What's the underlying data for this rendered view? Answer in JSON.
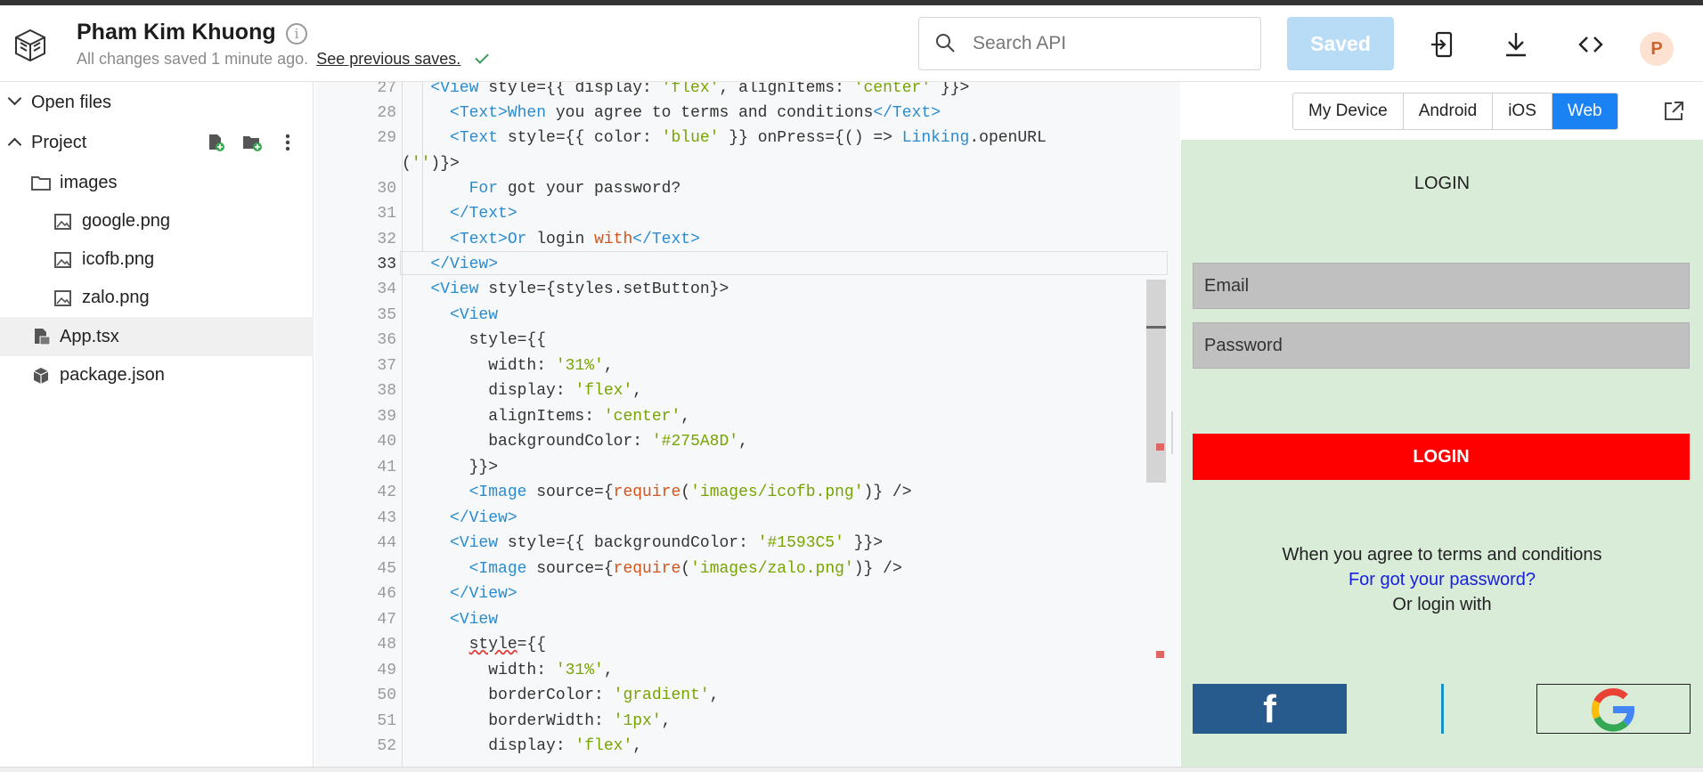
{
  "header": {
    "project_name": "Pham Kim Khuong",
    "save_status": "All changes saved 1 minute ago.",
    "previous_saves_link": "See previous saves.",
    "search_placeholder": "Search API",
    "saved_button": "Saved",
    "avatar_initial": "P"
  },
  "sidebar": {
    "open_files": "Open files",
    "project": "Project",
    "items": [
      {
        "label": "images"
      },
      {
        "label": "google.png"
      },
      {
        "label": "icofb.png"
      },
      {
        "label": "zalo.png"
      },
      {
        "label": "App.tsx"
      },
      {
        "label": "package.json"
      }
    ]
  },
  "editor": {
    "line_numbers": [
      "27",
      "28",
      "29",
      "",
      "30",
      "31",
      "32",
      "33",
      "34",
      "35",
      "36",
      "37",
      "38",
      "39",
      "40",
      "41",
      "42",
      "43",
      "44",
      "45",
      "46",
      "47",
      "48",
      "49",
      "50",
      "51",
      "52"
    ]
  },
  "preview": {
    "tabs": [
      "My Device",
      "Android",
      "iOS",
      "Web"
    ],
    "active_tab": "Web",
    "login_title": "LOGIN",
    "email_placeholder": "Email",
    "password_placeholder": "Password",
    "login_button": "LOGIN",
    "terms_text": "When you agree to terms and conditions",
    "forgot_text": "For got your password?",
    "or_login_text": "Or login with",
    "fb_letter": "f"
  },
  "colors": {
    "accent": "#1a82f2",
    "login_button": "#ff0000",
    "facebook": "#275A8D",
    "zalo": "#1593C5",
    "preview_bg": "#d8ecd8"
  }
}
